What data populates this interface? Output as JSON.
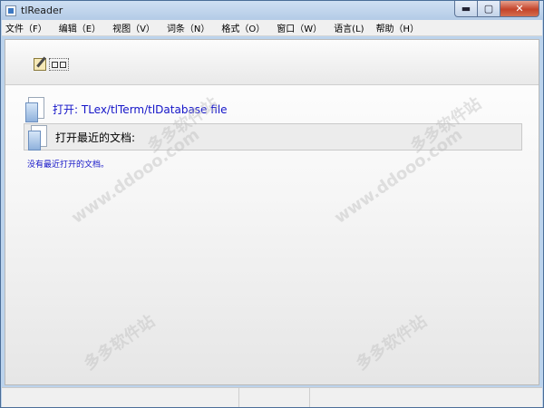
{
  "window": {
    "title": "tlReader"
  },
  "controls": {
    "minimize": "▬",
    "maximize": "▢",
    "close": "✕"
  },
  "menu": [
    "文件（F）",
    "编辑（E）",
    "视图（V）",
    "词条（N）",
    "格式（O）",
    "窗口（W）",
    "语言(L)",
    "帮助（H）"
  ],
  "content": {
    "open_link": "打开: TLex/tlTerm/tlDatabase file",
    "recent_title": "打开最近的文档:",
    "recent_empty": "没有最近打开的文档。"
  },
  "watermark": {
    "text": "多多软件站",
    "url": "www.ddooo.com"
  }
}
